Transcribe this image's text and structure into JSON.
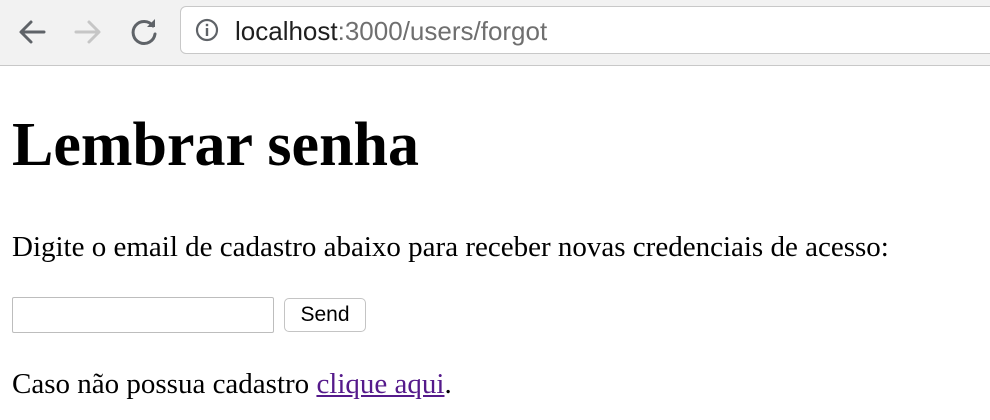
{
  "browser": {
    "url_host": "localhost",
    "url_rest": ":3000/users/forgot",
    "icons": {
      "back": "arrow-left-icon",
      "forward": "arrow-right-icon",
      "reload": "reload-icon",
      "info": "info-circle-icon"
    }
  },
  "page": {
    "title": "Lembrar senha",
    "instructions": "Digite o email de cadastro abaixo para receber novas credenciais de acesso:",
    "email_value": "",
    "send_label": "Send",
    "footer_prefix": "Caso não possua cadastro ",
    "footer_link": "clique aqui",
    "footer_suffix": ".",
    "link_color": "#551a8b"
  }
}
